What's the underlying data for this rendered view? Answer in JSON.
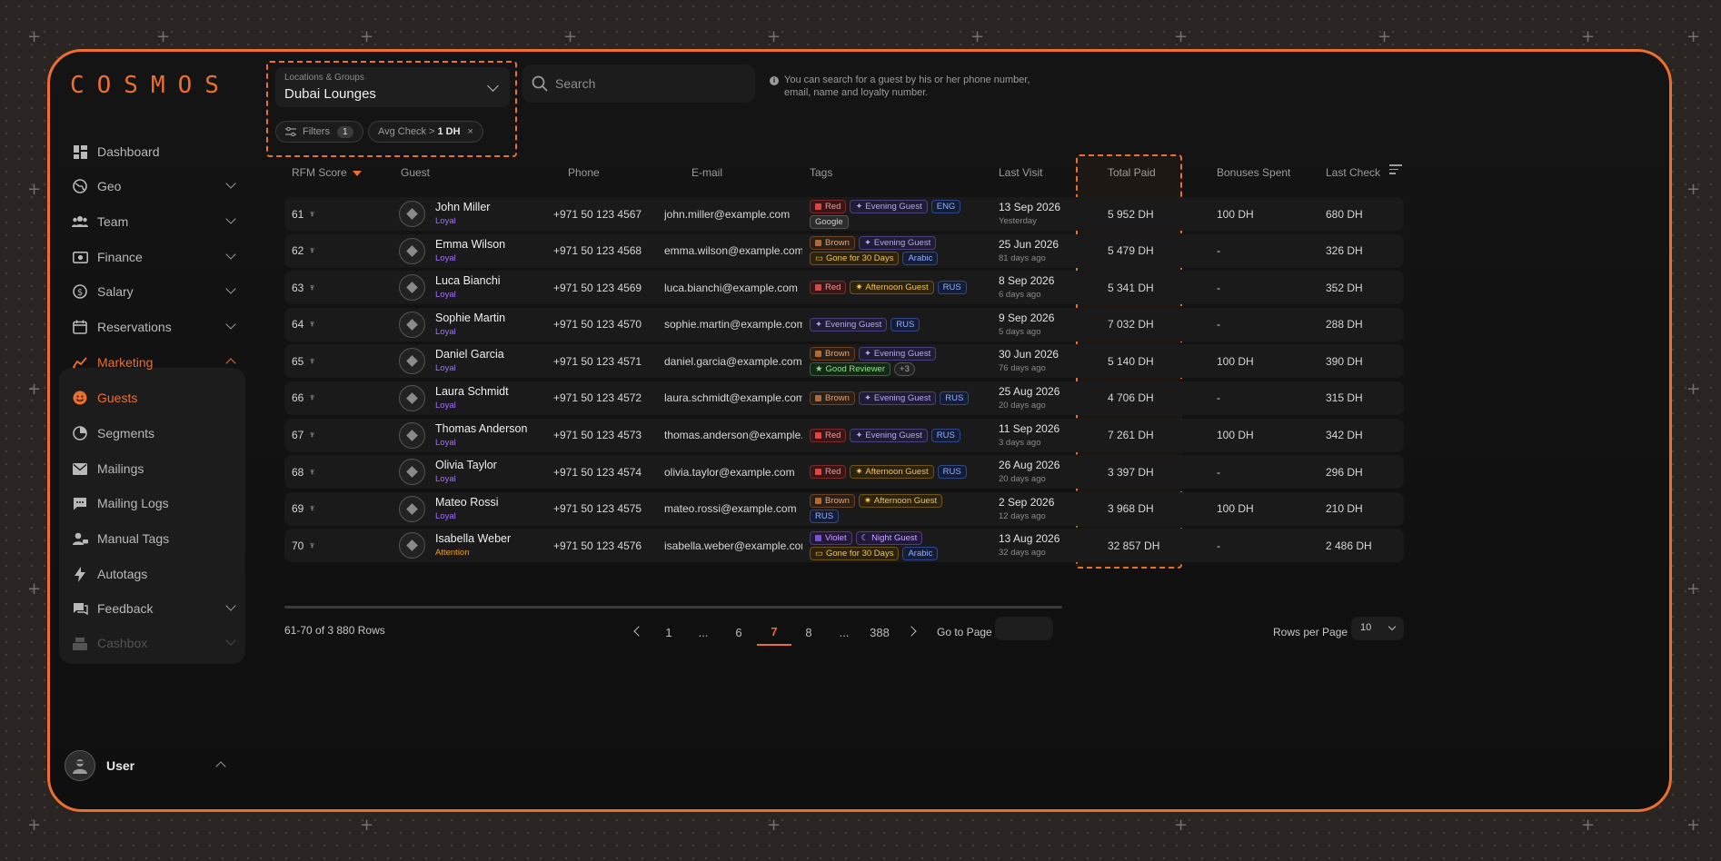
{
  "app": {
    "logo": "COSMOS"
  },
  "sidebar": {
    "items": [
      {
        "label": "Dashboard",
        "icon": "dashboard-icon"
      },
      {
        "label": "Geo",
        "icon": "globe-icon"
      },
      {
        "label": "Team",
        "icon": "team-icon"
      },
      {
        "label": "Finance",
        "icon": "finance-icon"
      },
      {
        "label": "Salary",
        "icon": "dollar-icon"
      },
      {
        "label": "Reservations",
        "icon": "calendar-icon"
      },
      {
        "label": "Marketing",
        "icon": "marketing-icon"
      },
      {
        "label": "Guests",
        "icon": "smiley-icon"
      },
      {
        "label": "Segments",
        "icon": "pie-icon"
      },
      {
        "label": "Mailings",
        "icon": "mail-icon"
      },
      {
        "label": "Mailing Logs",
        "icon": "chat-icon"
      },
      {
        "label": "Manual Tags",
        "icon": "user-tag-icon"
      },
      {
        "label": "Autotags",
        "icon": "bolt-icon"
      },
      {
        "label": "Feedback",
        "icon": "feedback-icon"
      },
      {
        "label": "Cashbox",
        "icon": "cashbox-icon"
      }
    ],
    "user": {
      "name": "User"
    }
  },
  "filters": {
    "location_label": "Locations & Groups",
    "location_value": "Dubai Lounges",
    "filters_label": "Filters",
    "filters_count": "1",
    "avg_check_label": "Avg Check >",
    "avg_check_value": "1 DH",
    "remove_symbol": "×"
  },
  "search": {
    "placeholder": "Search",
    "hint": "You can search for a guest by his or her phone number, email, name and loyalty number."
  },
  "table": {
    "headers": {
      "rfm": "RFM Score",
      "guest": "Guest",
      "phone": "Phone",
      "email": "E-mail",
      "tags": "Tags",
      "last_visit": "Last Visit",
      "total_paid": "Total Paid",
      "bonuses_spent": "Bonuses Spent",
      "last_check": "Last Check"
    },
    "rows": [
      {
        "rfm": "61",
        "name": "John Miller",
        "status": "Loyal",
        "phone": "+971 50 123 4567",
        "email": "john.miller@example.com",
        "tags": [
          {
            "text": "Red",
            "kind": "red"
          },
          {
            "text": "Evening Guest",
            "kind": "evening"
          },
          {
            "text": "ENG",
            "kind": "blue"
          },
          {
            "text": "Google",
            "kind": "google"
          }
        ],
        "visit_date": "13 Sep 2026",
        "visit_ago": "Yesterday",
        "paid": "5 952 DH",
        "bonus": "100 DH",
        "last_check": "680 DH"
      },
      {
        "rfm": "62",
        "name": "Emma Wilson",
        "status": "Loyal",
        "phone": "+971 50 123 4568",
        "email": "emma.wilson@example.com",
        "tags": [
          {
            "text": "Brown",
            "kind": "brown"
          },
          {
            "text": "Evening Guest",
            "kind": "evening"
          },
          {
            "text": "Gone for 30 Days",
            "kind": "gone"
          },
          {
            "text": "Arabic",
            "kind": "blue"
          }
        ],
        "visit_date": "25 Jun 2026",
        "visit_ago": "81 days ago",
        "paid": "5 479 DH",
        "bonus": "-",
        "last_check": "326 DH"
      },
      {
        "rfm": "63",
        "name": "Luca Bianchi",
        "status": "Loyal",
        "phone": "+971 50 123 4569",
        "email": "luca.bianchi@example.com",
        "tags": [
          {
            "text": "Red",
            "kind": "red"
          },
          {
            "text": "Afternoon Guest",
            "kind": "afternoon"
          },
          {
            "text": "RUS",
            "kind": "blue"
          }
        ],
        "visit_date": "8 Sep 2026",
        "visit_ago": "6 days ago",
        "paid": "5 341 DH",
        "bonus": "-",
        "last_check": "352 DH"
      },
      {
        "rfm": "64",
        "name": "Sophie Martin",
        "status": "Loyal",
        "phone": "+971 50 123 4570",
        "email": "sophie.martin@example.com",
        "tags": [
          {
            "text": "Evening Guest",
            "kind": "evening"
          },
          {
            "text": "RUS",
            "kind": "blue"
          }
        ],
        "visit_date": "9 Sep 2026",
        "visit_ago": "5 days ago",
        "paid": "7 032 DH",
        "bonus": "-",
        "last_check": "288 DH"
      },
      {
        "rfm": "65",
        "name": "Daniel Garcia",
        "status": "Loyal",
        "phone": "+971 50 123 4571",
        "email": "daniel.garcia@example.com",
        "tags": [
          {
            "text": "Brown",
            "kind": "brown"
          },
          {
            "text": "Evening Guest",
            "kind": "evening"
          },
          {
            "text": "Good Reviewer",
            "kind": "good"
          },
          {
            "text": "+3",
            "kind": "more"
          }
        ],
        "visit_date": "30 Jun 2026",
        "visit_ago": "76 days ago",
        "paid": "5 140 DH",
        "bonus": "100 DH",
        "last_check": "390 DH"
      },
      {
        "rfm": "66",
        "name": "Laura Schmidt",
        "status": "Loyal",
        "phone": "+971 50 123 4572",
        "email": "laura.schmidt@example.com",
        "tags": [
          {
            "text": "Brown",
            "kind": "brown"
          },
          {
            "text": "Evening Guest",
            "kind": "evening"
          },
          {
            "text": "RUS",
            "kind": "blue"
          }
        ],
        "visit_date": "25 Aug 2026",
        "visit_ago": "20 days ago",
        "paid": "4 706 DH",
        "bonus": "-",
        "last_check": "315 DH"
      },
      {
        "rfm": "67",
        "name": "Thomas Anderson",
        "status": "Loyal",
        "phone": "+971 50 123 4573",
        "email": "thomas.anderson@example.co",
        "tags": [
          {
            "text": "Red",
            "kind": "red"
          },
          {
            "text": "Evening Guest",
            "kind": "evening"
          },
          {
            "text": "RUS",
            "kind": "blue"
          }
        ],
        "visit_date": "11 Sep 2026",
        "visit_ago": "3 days ago",
        "paid": "7 261 DH",
        "bonus": "100 DH",
        "last_check": "342 DH"
      },
      {
        "rfm": "68",
        "name": "Olivia Taylor",
        "status": "Loyal",
        "phone": "+971 50 123 4574",
        "email": "olivia.taylor@example.com",
        "tags": [
          {
            "text": "Red",
            "kind": "red"
          },
          {
            "text": "Afternoon Guest",
            "kind": "afternoon"
          },
          {
            "text": "RUS",
            "kind": "blue"
          }
        ],
        "visit_date": "26 Aug 2026",
        "visit_ago": "20 days ago",
        "paid": "3 397 DH",
        "bonus": "-",
        "last_check": "296 DH"
      },
      {
        "rfm": "69",
        "name": "Mateo Rossi",
        "status": "Loyal",
        "phone": "+971 50 123 4575",
        "email": "mateo.rossi@example.com",
        "tags": [
          {
            "text": "Brown",
            "kind": "brown"
          },
          {
            "text": "Afternoon Guest",
            "kind": "afternoon"
          },
          {
            "text": "RUS",
            "kind": "blue"
          }
        ],
        "visit_date": "2 Sep 2026",
        "visit_ago": "12 days ago",
        "paid": "3 968 DH",
        "bonus": "100 DH",
        "last_check": "210 DH"
      },
      {
        "rfm": "70",
        "name": "Isabella Weber",
        "status": "Attention",
        "phone": "+971 50 123 4576",
        "email": "isabella.weber@example.com",
        "tags": [
          {
            "text": "Violet",
            "kind": "violet"
          },
          {
            "text": "Night Guest",
            "kind": "night"
          },
          {
            "text": "Gone for 30 Days",
            "kind": "gone"
          },
          {
            "text": "Arabic",
            "kind": "blue"
          }
        ],
        "visit_date": "13 Aug 2026",
        "visit_ago": "32 days ago",
        "paid": "32 857 DH",
        "bonus": "-",
        "last_check": "2 486 DH"
      }
    ]
  },
  "pagination": {
    "summary": "61-70 of 3 880 Rows",
    "pages": [
      "1",
      "...",
      "6",
      "7",
      "8",
      "...",
      "388"
    ],
    "current": "7",
    "goto_label": "Go to Page",
    "rows_per_page_label": "Rows per Page",
    "rows_per_page_value": "10"
  },
  "colors": {
    "accent": "#ec6f2d",
    "loyal": "#a070ff",
    "attention": "#f0a025"
  }
}
